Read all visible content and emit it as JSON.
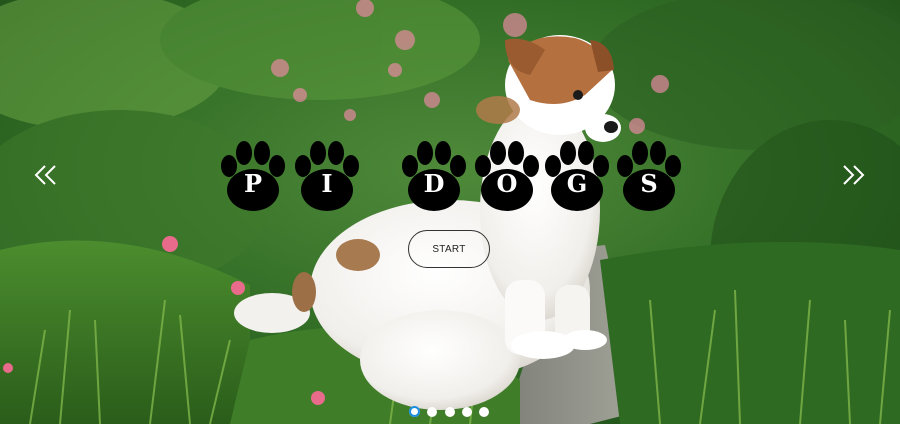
{
  "hero": {
    "background": "puppy-in-garden-photo",
    "logo_letters": [
      "P",
      "I",
      "D",
      "O",
      "G",
      "S"
    ],
    "start_label": "START",
    "slides": {
      "count": 5,
      "active": 1
    },
    "prev_icon": "double-chevron-left-icon",
    "next_icon": "double-chevron-right-icon"
  },
  "colors": {
    "paw": "#000000",
    "letter": "#ffffff",
    "active_dot": "#1a8ce0",
    "dot": "#ffffff"
  }
}
